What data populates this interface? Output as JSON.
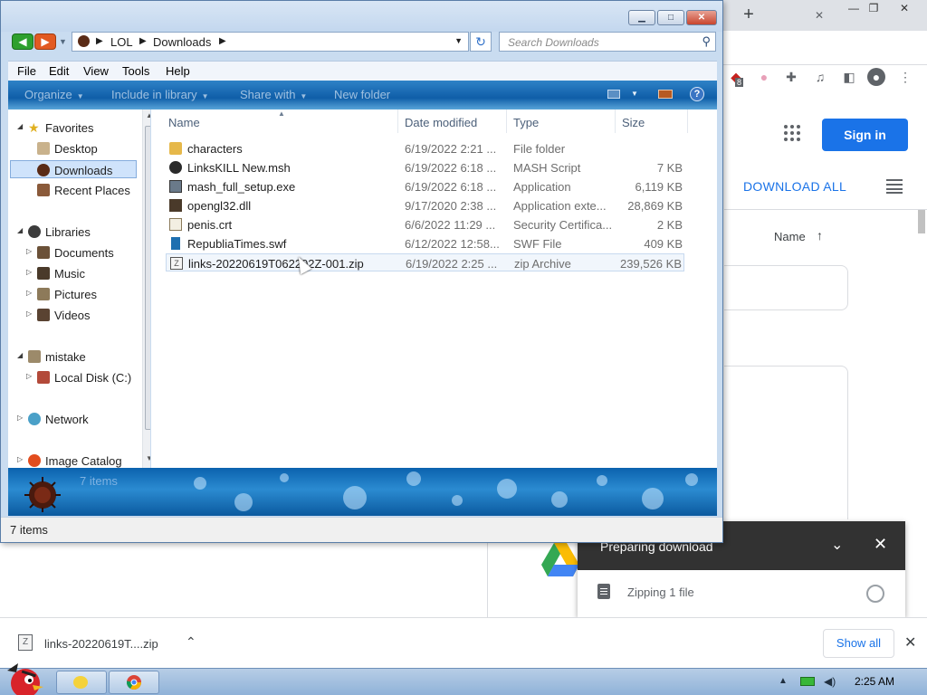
{
  "chrome": {
    "new_tab_glyph": "+",
    "tab_close_glyph": "✕",
    "extension_badge": "8",
    "signin_label": "Sign in",
    "download_all_label": "DOWNLOAD ALL",
    "name_column_label": "Name",
    "sort_glyph": "↑",
    "preparing": {
      "title": "Preparing download",
      "item_text": "Zipping 1 file"
    },
    "shelf": {
      "file_name": "links-20220619T....zip",
      "show_all_label": "Show all"
    }
  },
  "taskbar": {
    "clock": "2:25 AM"
  },
  "explorer": {
    "address": {
      "crumbs": [
        "LOL",
        "Downloads"
      ]
    },
    "search_placeholder": "Search Downloads",
    "menu": [
      "File",
      "Edit",
      "View",
      "Tools",
      "Help"
    ],
    "commands": [
      "Organize",
      "Include in library",
      "Share with",
      "New folder"
    ],
    "nav": {
      "favorites": "Favorites",
      "desktop": "Desktop",
      "downloads": "Downloads",
      "recent_places": "Recent Places",
      "libraries": "Libraries",
      "documents": "Documents",
      "music": "Music",
      "pictures": "Pictures",
      "videos": "Videos",
      "mistake": "mistake",
      "local_disk": "Local Disk (C:)",
      "network": "Network",
      "image_catalog": "Image Catalog"
    },
    "columns": [
      "Name",
      "Date modified",
      "Type",
      "Size"
    ],
    "files": [
      {
        "name": "characters",
        "date": "6/19/2022 2:21 ...",
        "type": "File folder",
        "size": "",
        "icon": "folder-icon"
      },
      {
        "name": "LinksKILL New.msh",
        "date": "6/19/2022 6:18 ...",
        "type": "MASH Script",
        "size": "7 KB",
        "icon": "mash-script-icon"
      },
      {
        "name": "mash_full_setup.exe",
        "date": "6/19/2022 6:18 ...",
        "type": "Application",
        "size": "6,119 KB",
        "icon": "installer-icon"
      },
      {
        "name": "opengl32.dll",
        "date": "9/17/2020 2:38 ...",
        "type": "Application exte...",
        "size": "28,869 KB",
        "icon": "dll-icon"
      },
      {
        "name": "penis.crt",
        "date": "6/6/2022 11:29 ...",
        "type": "Security Certifica...",
        "size": "2 KB",
        "icon": "certificate-icon"
      },
      {
        "name": "RepubliaTimes.swf",
        "date": "6/12/2022 12:58...",
        "type": "SWF File",
        "size": "409 KB",
        "icon": "swf-icon"
      },
      {
        "name": "links-20220619T062202Z-001.zip",
        "date": "6/19/2022 2:25 ...",
        "type": "zip Archive",
        "size": "239,526 KB",
        "icon": "zip-icon"
      }
    ],
    "details_count": "7 items",
    "status": "7 items",
    "colors": {
      "command_bar": "#0f5ea8",
      "selection": "#cfe3fb",
      "chrome_blue": "#1a73e8"
    }
  }
}
